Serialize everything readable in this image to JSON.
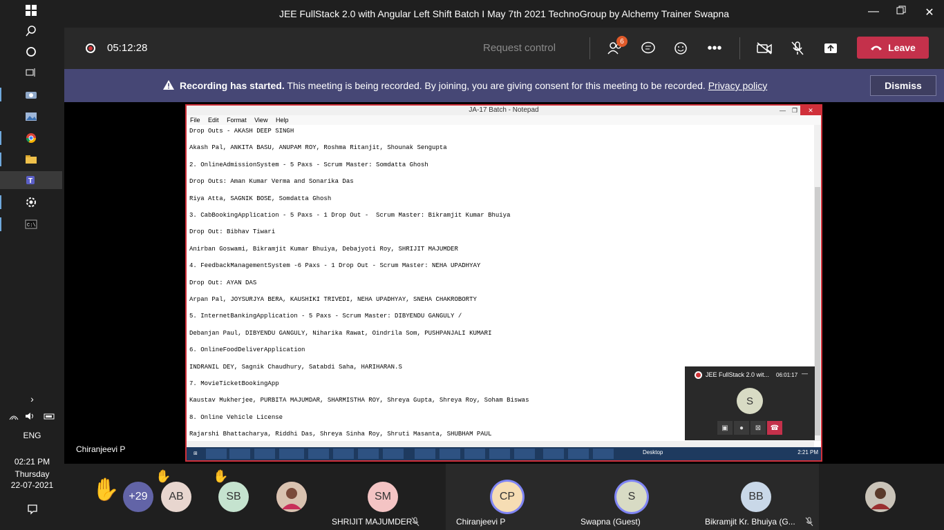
{
  "taskbar": {
    "time": "02:21 PM",
    "day": "Thursday",
    "date": "22-07-2021",
    "lang": "ENG"
  },
  "window": {
    "title": "JEE FullStack 2.0 with Angular Left Shift Batch I May 7th 2021 TechnoGroup by Alchemy Trainer Swapna"
  },
  "meeting": {
    "timer": "05:12:28",
    "request_control": "Request control",
    "participants_badge": "6",
    "leave_label": "Leave"
  },
  "banner": {
    "bold_text": "Recording has started.",
    "text": " This meeting is being recorded. By joining, you are giving consent for this meeting to be recorded. ",
    "link": "Privacy policy",
    "dismiss": "Dismiss"
  },
  "notepad": {
    "title": "JA-17 Batch - Notepad",
    "menu": [
      "File",
      "Edit",
      "Format",
      "View",
      "Help"
    ],
    "lines": [
      "Drop Outs - AKASH DEEP SINGH",
      "Akash Pal, ANKITA BASU, ANUPAM ROY, Roshma Ritanjit, Shounak Sengupta",
      "2. OnlineAdmissionSystem - 5 Paxs - Scrum Master: Somdatta Ghosh",
      "Drop Outs: Aman Kumar Verma and Sonarika Das",
      "Riya Atta, SAGNIK BOSE, Somdatta Ghosh",
      "3. CabBookingApplication - 5 Paxs - 1 Drop Out -  Scrum Master: Bikramjit Kumar Bhuiya",
      "Drop Out: Bibhav Tiwari",
      "Anirban Goswami, Bikramjit Kumar Bhuiya, Debajyoti Roy, SHRIJIT MAJUMDER",
      "4. FeedbackManagementSystem -6 Paxs - 1 Drop Out - Scrum Master: NEHA UPADHYAY",
      "Drop Out: AYAN DAS",
      "Arpan Pal, JOYSURJYA BERA, KAUSHIKI TRIVEDI, NEHA UPADHYAY, SNEHA CHAKROBORTY",
      "5. InternetBankingApplication - 5 Paxs - Scrum Master: DIBYENDU GANGULY /",
      "Debanjan Paul, DIBYENDU GANGULY, Niharika Rawat, Oindrila Som, PUSHPANJALI KUMARI",
      "6. OnlineFoodDeliverApplication",
      "INDRANIL DEY, Sagnik Chaudhury, Satabdi Saha, HARIHARAN.S",
      "7. MovieTicketBookingApp",
      "Kaustav Mukherjee, PURBITA MAJUMDAR, SHARMISTHA ROY, Shreya Gupta, Shreya Roy, Soham Biswas",
      "8. Online Vehicle License",
      "Rajarshi Bhattacharya, Riddhi Das, Shreya Sinha Roy, Shruti Masanta, SHUBHAM PAUL"
    ],
    "taskbar_desktop": "Desktop",
    "taskbar_clock": "2:21 PM"
  },
  "mini_meeting": {
    "title": "JEE FullStack 2.0 wit...",
    "time": "06:01:17",
    "avatar": "S"
  },
  "presenter": "Chiranjeevi P",
  "participants": {
    "overflow": "+29",
    "small": [
      {
        "initials": "AB",
        "color": "#e8d6cf"
      },
      {
        "initials": "SB",
        "color": "#c5e3cf"
      }
    ],
    "tiles": [
      {
        "initials": "SM",
        "name": "SHRIJIT MAJUMDER",
        "color": "#f4c4c4"
      },
      {
        "initials": "CP",
        "name": "Chiranjeevi P",
        "color": "#f6ddb4"
      },
      {
        "initials": "S",
        "name": "Swapna (Guest)",
        "color": "#d8dbc4"
      },
      {
        "initials": "BB",
        "name": "Bikramjit Kr. Bhuiya (G...",
        "color": "#c9d8e8"
      }
    ]
  }
}
